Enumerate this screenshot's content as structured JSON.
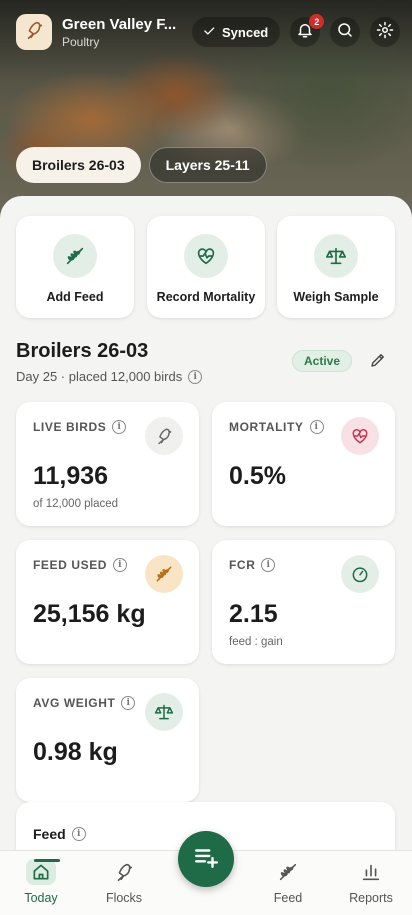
{
  "header": {
    "farm_name": "Green Valley F...",
    "farm_type": "Poultry",
    "sync_status": "Synced",
    "notification_count": "2",
    "icons": [
      "bird-logo-icon",
      "check-icon",
      "bell-icon",
      "search-icon",
      "gear-icon"
    ]
  },
  "flock_tabs": [
    {
      "label": "Broilers 26-03",
      "active": true
    },
    {
      "label": "Layers 25-11",
      "active": false
    }
  ],
  "quick_actions": [
    {
      "label": "Add Feed",
      "icon": "wheat-icon"
    },
    {
      "label": "Record Mortality",
      "icon": "heart-pulse-icon"
    },
    {
      "label": "Weigh Sample",
      "icon": "scale-icon"
    }
  ],
  "flock": {
    "name": "Broilers 26-03",
    "subtitle": "Day 25 · placed 12,000 birds",
    "status": "Active"
  },
  "stats": {
    "live_birds": {
      "label": "LIVE BIRDS",
      "value": "11,936",
      "sub": "of 12,000 placed"
    },
    "mortality": {
      "label": "MORTALITY",
      "value": "0.5%"
    },
    "feed_used": {
      "label": "FEED USED",
      "value": "25,156 kg"
    },
    "fcr": {
      "label": "FCR",
      "value": "2.15",
      "sub": "feed : gain"
    },
    "avg_weight": {
      "label": "AVG WEIGHT",
      "value": "0.98 kg"
    }
  },
  "feed_section": {
    "title": "Feed"
  },
  "bottom_nav": [
    {
      "label": "Today",
      "active": true
    },
    {
      "label": "Flocks"
    },
    {
      "label": "Feed"
    },
    {
      "label": "Reports"
    }
  ],
  "colors": {
    "brand_green": "#1f6b47",
    "mortality_red": "#c8334a",
    "feed_orange": "#d9892a",
    "badge_red": "#d12b2b"
  }
}
